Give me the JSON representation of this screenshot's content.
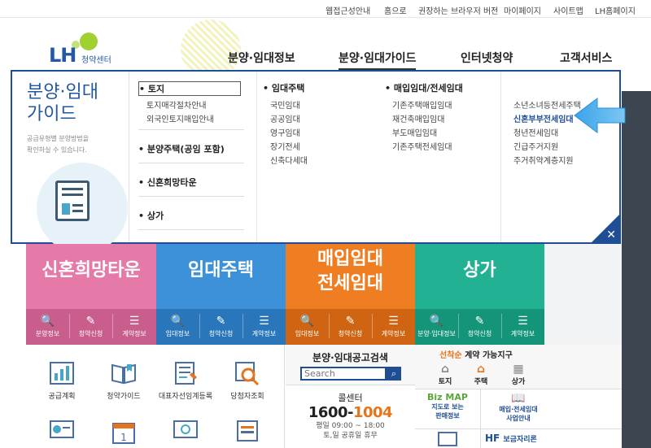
{
  "top_links": [
    "웹접근성안내",
    "홈으로",
    "권장하는 브라우저 버전",
    "마이페이지",
    "사이트맵",
    "LH홈페이지"
  ],
  "logo": {
    "brand": "LH",
    "sub": "청약센터"
  },
  "gnb": [
    "분양·임대정보",
    "분양·임대가이드",
    "인터넷청약",
    "고객서비스"
  ],
  "dropdown": {
    "title_line1": "분양·임대",
    "title_line2": "가이드",
    "desc_line1": "공급유형별 분양방법을",
    "desc_line2": "확인하실 수 있습니다.",
    "col1": {
      "head1": "토지",
      "items1": [
        "토지매각절차안내",
        "외국인토지매입안내"
      ],
      "head2": "분양주택(공임 포함)",
      "head3": "신혼희망타운",
      "head4": "상가"
    },
    "col2": {
      "head": "임대주택",
      "items": [
        "국민임대",
        "공공임대",
        "영구임대",
        "장기전세",
        "신축다세대"
      ]
    },
    "col3": {
      "head": "매입임대/전세임대",
      "items": [
        "기존주택매입임대",
        "재건축매입임대",
        "부도매입임대",
        "기존주택전세임대"
      ]
    },
    "col4": {
      "items": [
        "소년소녀등전세주택",
        "신혼부부전세임대",
        "청년전세임대",
        "긴급주거지원",
        "주거취약계층지원"
      ]
    }
  },
  "tiles": [
    {
      "title": "신혼희망타운",
      "color": "#e57aa8",
      "dark": "#c95e8d",
      "icons": [
        "분양정보",
        "청약신청",
        "계약정보"
      ]
    },
    {
      "title": "임대주택",
      "color": "#3d91d9",
      "dark": "#2a76bb",
      "icons": [
        "임대정보",
        "청약신청",
        "계약정보"
      ]
    },
    {
      "title_line1": "매입임대",
      "title_line2": "전세임대",
      "color": "#ef7d22",
      "dark": "#cf6512",
      "icons": [
        "임대정보",
        "청약신청",
        "계약정보"
      ]
    },
    {
      "title": "상가",
      "color": "#22b192",
      "dark": "#14957a",
      "icons": [
        "분양·임대정보",
        "청약신청",
        "계약정보"
      ]
    }
  ],
  "bottom_icons": [
    "공급계획",
    "청약가이드",
    "대표자선임계등록",
    "당첨자조회"
  ],
  "search": {
    "title": "분양·임대공고검색",
    "placeholder": "Search"
  },
  "call": {
    "head": "콜센터",
    "num_a": "1600-",
    "num_b": "1004",
    "hours": "평일 09:00 ~ 18:00",
    "holiday": "토,일 공휴일 휴무"
  },
  "near": {
    "accent": "선착순",
    "rest": " 계약 가능지구",
    "items": [
      "토지",
      "주택",
      "상가"
    ]
  },
  "right_links": {
    "bizmap_line1": "지도로 보는",
    "bizmap_line2": "판매정보",
    "biz_logo": "Biz MAP",
    "lease_line1": "매입·전세임대",
    "lease_line2": "사업안내",
    "hf": "보금자리론"
  }
}
